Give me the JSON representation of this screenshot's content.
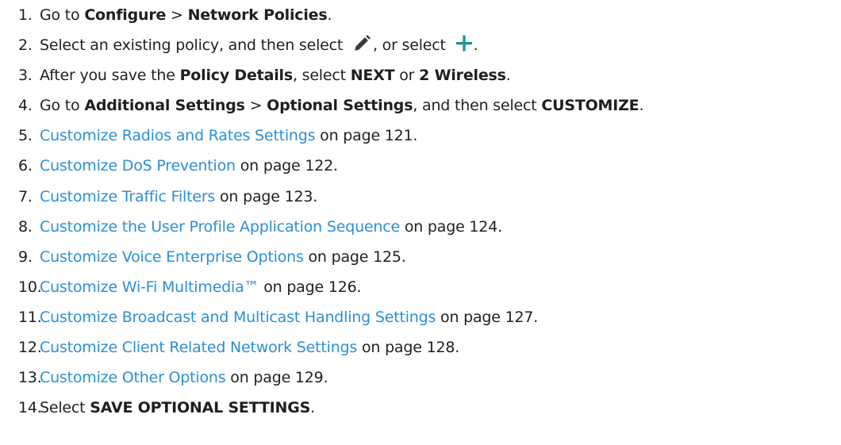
{
  "steps": [
    {
      "num": "1.",
      "parts": [
        {
          "t": "Go to "
        },
        {
          "t": "Configure",
          "b": true
        },
        {
          "t": " > "
        },
        {
          "t": "Network Policies",
          "b": true
        },
        {
          "t": "."
        }
      ]
    },
    {
      "num": "2.",
      "parts": [
        {
          "t": "Select an existing policy, and then select "
        },
        {
          "icon": "pencil-icon"
        },
        {
          "t": ", or select "
        },
        {
          "icon": "plus-icon"
        },
        {
          "t": "."
        }
      ]
    },
    {
      "num": "3.",
      "parts": [
        {
          "t": "After you save the "
        },
        {
          "t": "Policy Details",
          "b": true
        },
        {
          "t": ", select "
        },
        {
          "t": "NEXT",
          "b": true
        },
        {
          "t": " or "
        },
        {
          "t": "2 Wireless",
          "b": true
        },
        {
          "t": "."
        }
      ]
    },
    {
      "num": "4.",
      "parts": [
        {
          "t": "Go to "
        },
        {
          "t": "Additional Settings",
          "b": true
        },
        {
          "t": " > "
        },
        {
          "t": "Optional Settings",
          "b": true
        },
        {
          "t": ", and then select "
        },
        {
          "t": "CUSTOMIZE",
          "b": true
        },
        {
          "t": "."
        }
      ]
    },
    {
      "num": "5.",
      "parts": [
        {
          "t": "Customize Radios and Rates Settings",
          "link": true
        },
        {
          "t": " on page 121."
        }
      ]
    },
    {
      "num": "6.",
      "parts": [
        {
          "t": "Customize DoS Prevention",
          "link": true
        },
        {
          "t": " on page 122."
        }
      ]
    },
    {
      "num": "7.",
      "parts": [
        {
          "t": "Customize Traffic Filters",
          "link": true
        },
        {
          "t": " on page 123."
        }
      ]
    },
    {
      "num": "8.",
      "parts": [
        {
          "t": "Customize the User Profile Application Sequence",
          "link": true
        },
        {
          "t": " on page 124."
        }
      ]
    },
    {
      "num": "9.",
      "parts": [
        {
          "t": "Customize Voice Enterprise Options",
          "link": true
        },
        {
          "t": " on page 125."
        }
      ]
    },
    {
      "num": "10.",
      "parts": [
        {
          "t": "Customize Wi-Fi Multimedia™",
          "link": true
        },
        {
          "t": " on page 126."
        }
      ]
    },
    {
      "num": "11.",
      "parts": [
        {
          "t": "Customize Broadcast and Multicast Handling Settings",
          "link": true
        },
        {
          "t": " on page 127."
        }
      ]
    },
    {
      "num": "12.",
      "parts": [
        {
          "t": "Customize Client Related Network Settings",
          "link": true
        },
        {
          "t": " on page 128."
        }
      ]
    },
    {
      "num": "13.",
      "parts": [
        {
          "t": "Customize Other Options",
          "link": true
        },
        {
          "t": " on page 129."
        }
      ]
    },
    {
      "num": "14.",
      "parts": [
        {
          "t": "Select "
        },
        {
          "t": "SAVE OPTIONAL SETTINGS",
          "b": true
        },
        {
          "t": "."
        }
      ]
    }
  ],
  "colors": {
    "text": "#1f1f1f",
    "link": "#2b8fd6",
    "pencil_icon": "#3a3a3a",
    "plus_icon": "#1c8ea0"
  }
}
